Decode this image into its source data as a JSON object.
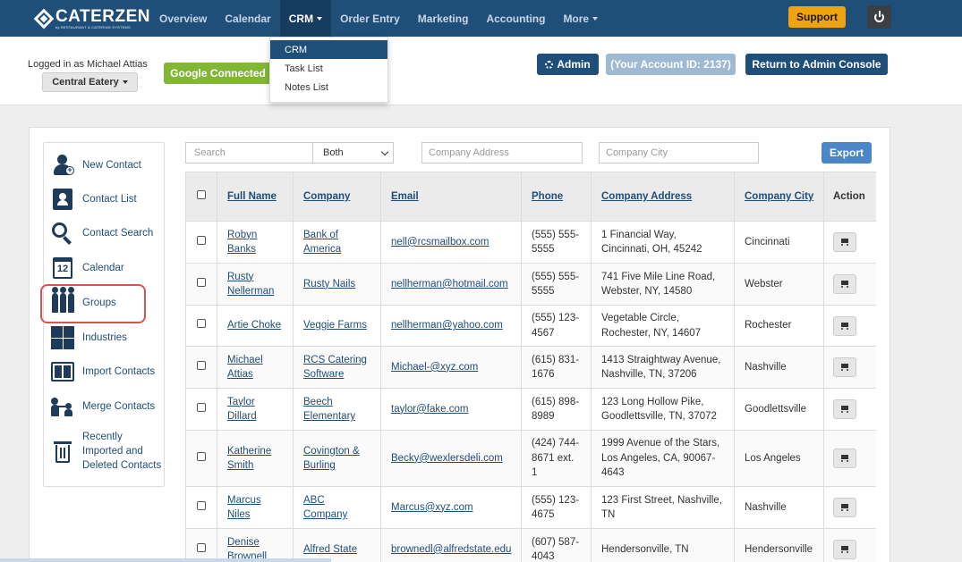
{
  "brand": {
    "name": "CATERZEN",
    "subtitle": "by RESTAURANT & CATERING SYSTEMS"
  },
  "nav": {
    "items": [
      {
        "label": "Overview"
      },
      {
        "label": "Calendar"
      },
      {
        "label": "CRM"
      },
      {
        "label": "Order Entry"
      },
      {
        "label": "Marketing"
      },
      {
        "label": "Accounting"
      },
      {
        "label": "More"
      }
    ],
    "support_label": "Support"
  },
  "crm_menu": [
    {
      "label": "CRM"
    },
    {
      "label": "Task List"
    },
    {
      "label": "Notes List"
    }
  ],
  "header": {
    "logged_in_text": "Logged in as Michael Attias",
    "location_label": "Central Eatery",
    "google_label": "Google Connected",
    "admin_label": "Admin",
    "account_id_label": "(Your Account ID: 2137)",
    "console_label": "Return to Admin Console"
  },
  "sidebar": {
    "items": [
      {
        "label": "New Contact"
      },
      {
        "label": "Contact List"
      },
      {
        "label": "Contact Search"
      },
      {
        "label": "Calendar"
      },
      {
        "label": "Groups"
      },
      {
        "label": "Industries"
      },
      {
        "label": "Import Contacts"
      },
      {
        "label": "Merge Contacts"
      },
      {
        "label_lines": [
          "Recently",
          "Imported and",
          "Deleted Contacts"
        ]
      }
    ]
  },
  "filters": {
    "search_placeholder": "Search",
    "scope_value": "Both",
    "address_placeholder": "Company Address",
    "city_placeholder": "Company City",
    "export_label": "Export"
  },
  "table": {
    "headers": [
      "Full Name",
      "Company",
      "Email",
      "Phone",
      "Company Address",
      "Company City",
      "Action"
    ],
    "rows": [
      {
        "name": [
          "Robyn",
          "Banks"
        ],
        "company": [
          "Bank of",
          "America"
        ],
        "email": "nell@rcsmailbox.com",
        "phone": [
          "(555) 555-",
          "5555"
        ],
        "address": [
          "1 Financial Way,",
          "Cincinnati, OH, 45242"
        ],
        "city": "Cincinnati"
      },
      {
        "name": [
          "Rusty",
          "Nellerman"
        ],
        "company": [
          "Rusty Nails"
        ],
        "email": "nellherman@hotmail.com",
        "phone": [
          "(555) 555-",
          "5555"
        ],
        "address": [
          "741 Five Mile Line Road,",
          "Webster, NY, 14580"
        ],
        "city": "Webster"
      },
      {
        "name": [
          "Artie Choke"
        ],
        "company": [
          "Veggie Farms"
        ],
        "email": "nellherman@yahoo.com",
        "phone": [
          "(555) 123-",
          "4567"
        ],
        "address": [
          "Vegetable Circle,",
          "Rochester, NY, 14607"
        ],
        "city": "Rochester"
      },
      {
        "name": [
          "Michael",
          "Attias"
        ],
        "company": [
          "RCS Catering",
          "Software"
        ],
        "email": "Michael-@xyz.com",
        "phone": [
          "(615) 831-",
          "1676"
        ],
        "address": [
          "1413 Straightway Avenue,",
          "Nashville, TN, 37206"
        ],
        "city": "Nashville"
      },
      {
        "name": [
          "Taylor",
          "Dillard"
        ],
        "company": [
          "Beech",
          "Elementary"
        ],
        "email": "taylor@fake.com",
        "phone": [
          "(615) 898-",
          "8989"
        ],
        "address": [
          "123 Long Hollow Pike,",
          "Goodlettsville, TN, 37072"
        ],
        "city": "Goodlettsville"
      },
      {
        "name": [
          "Katherine",
          "Smith"
        ],
        "company": [
          "Covington &",
          "Burling"
        ],
        "email": "Becky@wexlersdeli.com",
        "phone": [
          "(424) 744-",
          "8671 ext.",
          "1"
        ],
        "address": [
          "1999 Avenue of the Stars,",
          "Los Angeles, CA, 90067-",
          "4643"
        ],
        "city": "Los Angeles"
      },
      {
        "name": [
          "Marcus",
          "Niles"
        ],
        "company": [
          "ABC",
          "Company"
        ],
        "email": "Marcus@xyz.com",
        "phone": [
          "(555) 123-",
          "4675"
        ],
        "address": [
          "123 First Street, Nashville,",
          "TN"
        ],
        "city": "Nashville"
      },
      {
        "name": [
          "Denise",
          "Brownell"
        ],
        "company": [
          "Alfred State"
        ],
        "email": "brownedl@alfredstate.edu",
        "phone": [
          "(607) 587-",
          "4043"
        ],
        "address": [
          "Hendersonville, TN"
        ],
        "city": "Hendersonville"
      }
    ]
  },
  "colors": {
    "navbar": "#1f4e79",
    "support": "#f0a30a",
    "google": "#82b735",
    "link": "#1f4e79",
    "highlight": "#d9534f"
  }
}
